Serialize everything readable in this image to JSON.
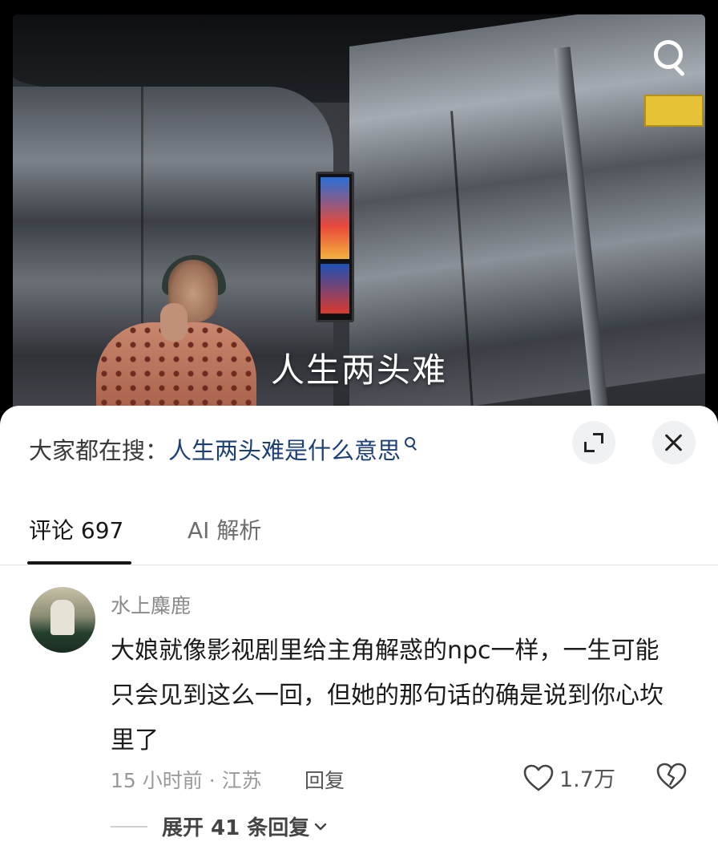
{
  "video": {
    "subtitle": "人生两头难"
  },
  "search_bar": {
    "prefix": "大家都在搜：",
    "query": "人生两头难是什么意思"
  },
  "tabs": [
    {
      "label": "评论 697",
      "active": true
    },
    {
      "label": "AI 解析",
      "active": false
    }
  ],
  "comment": {
    "author": "水上麋鹿",
    "text": "大娘就像影视剧里给主角解惑的npc一样，一生可能只会见到这么一回，但她的那句话的确是说到你心坎里了",
    "meta": "15 小时前 · 江苏",
    "reply_label": "回复",
    "likes": "1.7万",
    "expand_replies": "展开 41 条回复"
  },
  "colors": {
    "link": "#1c3f78",
    "text_primary": "#1b1b1b",
    "text_secondary": "#8a8a8a",
    "sheet_bg": "#ffffff",
    "button_bg": "#f0f1f3"
  },
  "icons": {
    "top_right": "search-icon",
    "sheet_actions": [
      "expand-icon",
      "close-icon"
    ],
    "comment_actions": [
      "heart-icon",
      "dislike-heart-icon",
      "chevron-down-icon"
    ]
  }
}
